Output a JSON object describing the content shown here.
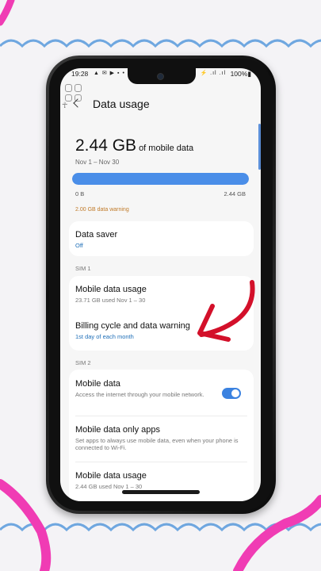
{
  "colors": {
    "accent": "#4a8ee8",
    "link": "#1f6fb8",
    "warning": "#c07a28",
    "arrow": "#d3102a",
    "decor_blue": "#6fa7e0",
    "decor_pink": "#f03cb4"
  },
  "statusbar": {
    "time": "19:28",
    "left_icons": "▲ ✉ ▶ ▪ •",
    "signal": "⚡ .ıl .ıl",
    "battery": "100%▮"
  },
  "header": {
    "title": "Data usage",
    "back_icon": "chevron-left-icon"
  },
  "summary": {
    "amount": "2.44 GB",
    "amount_suffix": "of mobile data",
    "date_range": "Nov 1 – Nov 30",
    "bar_fill_fraction": 1.0,
    "bar_min": "0 B",
    "bar_max": "2.44 GB",
    "warning": "2.00 GB data warning"
  },
  "data_saver": {
    "title": "Data saver",
    "status": "Off"
  },
  "sim1": {
    "label": "SIM 1",
    "mobile_data_usage": {
      "title": "Mobile data usage",
      "sub": "23.71 GB used Nov 1 – 30"
    },
    "billing": {
      "title": "Billing cycle and data warning",
      "sub": "1st day of each month"
    }
  },
  "sim2": {
    "label": "SIM 2",
    "mobile_data": {
      "title": "Mobile data",
      "sub": "Access the internet through your mobile network.",
      "enabled": true
    },
    "mobile_data_only_apps": {
      "title": "Mobile data only apps",
      "sub": "Set apps to always use mobile data, even when your phone is connected to Wi-Fi."
    },
    "mobile_data_usage": {
      "title": "Mobile data usage",
      "sub": "2.44 GB used Nov 1 – 30"
    }
  }
}
